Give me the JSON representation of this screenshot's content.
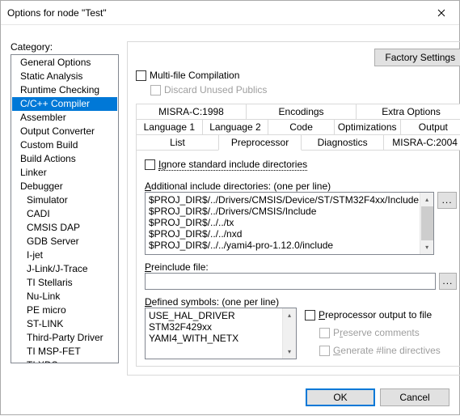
{
  "window": {
    "title": "Options for node \"Test\""
  },
  "category_label": "Category:",
  "categories": [
    {
      "label": "General Options",
      "indent": 1
    },
    {
      "label": "Static Analysis",
      "indent": 1
    },
    {
      "label": "Runtime Checking",
      "indent": 1
    },
    {
      "label": "C/C++ Compiler",
      "indent": 1,
      "selected": true
    },
    {
      "label": "Assembler",
      "indent": 1
    },
    {
      "label": "Output Converter",
      "indent": 1
    },
    {
      "label": "Custom Build",
      "indent": 1
    },
    {
      "label": "Build Actions",
      "indent": 1
    },
    {
      "label": "Linker",
      "indent": 1
    },
    {
      "label": "Debugger",
      "indent": 1
    },
    {
      "label": "Simulator",
      "indent": 2
    },
    {
      "label": "CADI",
      "indent": 2
    },
    {
      "label": "CMSIS DAP",
      "indent": 2
    },
    {
      "label": "GDB Server",
      "indent": 2
    },
    {
      "label": "I-jet",
      "indent": 2
    },
    {
      "label": "J-Link/J-Trace",
      "indent": 2
    },
    {
      "label": "TI Stellaris",
      "indent": 2
    },
    {
      "label": "Nu-Link",
      "indent": 2
    },
    {
      "label": "PE micro",
      "indent": 2
    },
    {
      "label": "ST-LINK",
      "indent": 2
    },
    {
      "label": "Third-Party Driver",
      "indent": 2
    },
    {
      "label": "TI MSP-FET",
      "indent": 2
    },
    {
      "label": "TI XDS",
      "indent": 2
    }
  ],
  "buttons": {
    "factory": "Factory Settings",
    "ok": "OK",
    "cancel": "Cancel",
    "browse": "..."
  },
  "multi_file": {
    "label": "Multi-file Compilation",
    "discard": "Discard Unused Publics"
  },
  "tabs_row1": [
    "MISRA-C:1998",
    "Encodings",
    "Extra Options"
  ],
  "tabs_row2": [
    "Language 1",
    "Language 2",
    "Code",
    "Optimizations",
    "Output"
  ],
  "tabs_row3": [
    "List",
    "Preprocessor",
    "Diagnostics",
    "MISRA-C:2004"
  ],
  "active_tab": "Preprocessor",
  "preproc": {
    "ignore_label": "Ignore standard include directories",
    "add_inc_label": "Additional include directories: (one per line)",
    "include_dirs": [
      "$PROJ_DIR$/../Drivers/CMSIS/Device/ST/STM32F4xx/Include",
      "$PROJ_DIR$/../Drivers/CMSIS/Include",
      "$PROJ_DIR$/../../tx",
      "$PROJ_DIR$/../../nxd",
      "$PROJ_DIR$/../../yami4-pro-1.12.0/include"
    ],
    "preinc_label": "Preinclude file:",
    "preinc_value": "",
    "defined_label": "Defined symbols: (one per line)",
    "defined_symbols": [
      "USE_HAL_DRIVER",
      "STM32F429xx",
      "YAMI4_WITH_NETX"
    ],
    "pp_to_file": "Preprocessor output to file",
    "preserve": "Preserve comments",
    "genline": "Generate #line directives"
  }
}
